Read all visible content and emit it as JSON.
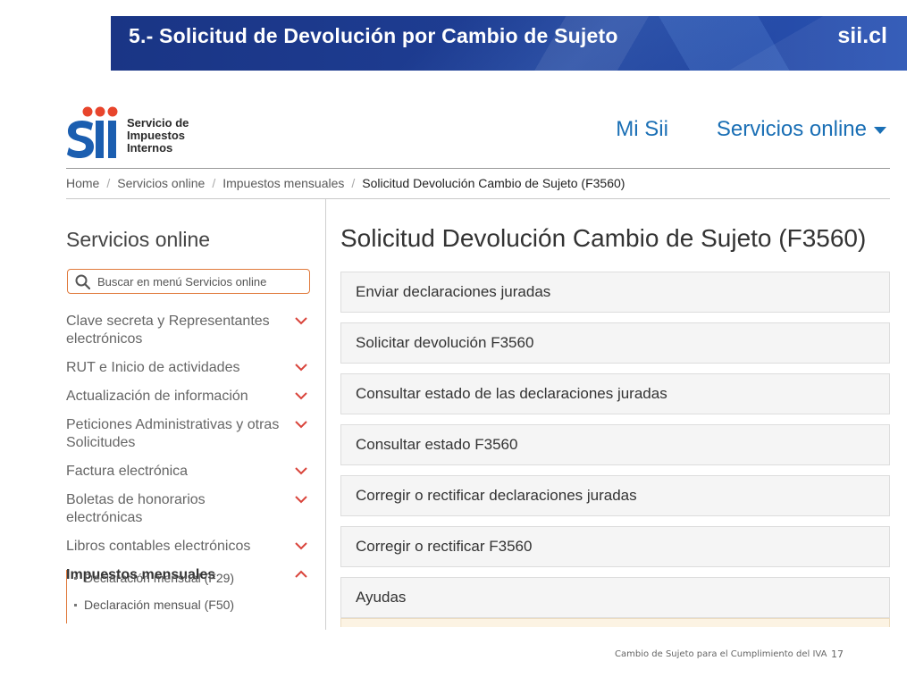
{
  "slide": {
    "title": "5.- Solicitud de Devolución por Cambio de Sujeto",
    "brand": "sii.cl",
    "footer_note": "Cambio de Sujeto para el Cumplimiento del IVA",
    "page_number": "17"
  },
  "site": {
    "logo": {
      "lines": [
        "Servicio de",
        "Impuestos",
        "Internos"
      ]
    },
    "topnav": {
      "mi_sii": "Mi Sii",
      "servicios_online": "Servicios online"
    },
    "breadcrumb": [
      "Home",
      "Servicios online",
      "Impuestos mensuales",
      "Solicitud Devolución Cambio de Sujeto (F3560)"
    ],
    "sidebar": {
      "title": "Servicios online",
      "search_placeholder": "Buscar en menú Servicios online",
      "menu": [
        {
          "label": "Clave secreta y Representantes electrónicos",
          "expanded": false
        },
        {
          "label": "RUT e Inicio de actividades",
          "expanded": false
        },
        {
          "label": "Actualización de información",
          "expanded": false
        },
        {
          "label": "Peticiones Administrativas y otras Solicitudes",
          "expanded": false
        },
        {
          "label": "Factura electrónica",
          "expanded": false
        },
        {
          "label": "Boletas de honorarios electrónicas",
          "expanded": false
        },
        {
          "label": "Libros contables electrónicos",
          "expanded": false
        },
        {
          "label": "Impuestos mensuales",
          "expanded": true
        }
      ],
      "submenu": [
        "Declaración mensual (F29)",
        "Declaración mensual (F50)"
      ]
    },
    "main": {
      "title": "Solicitud Devolución Cambio de Sujeto (F3560)",
      "panels": [
        "Enviar declaraciones juradas",
        "Solicitar devolución F3560",
        "Consultar estado de las declaraciones juradas",
        "Consultar estado F3560",
        "Corregir o rectificar declaraciones juradas",
        "Corregir o rectificar F3560",
        "Ayudas"
      ]
    }
  },
  "colors": {
    "header_blue": "#1d3a8c",
    "link_blue": "#1a6fb5",
    "accent_orange": "#e07a3c",
    "chevron_red": "#d9443b"
  },
  "icons": {
    "search": "search-icon",
    "chevron_down": "chevron-down-icon",
    "chevron_up": "chevron-up-icon",
    "caret": "caret-down-icon"
  }
}
